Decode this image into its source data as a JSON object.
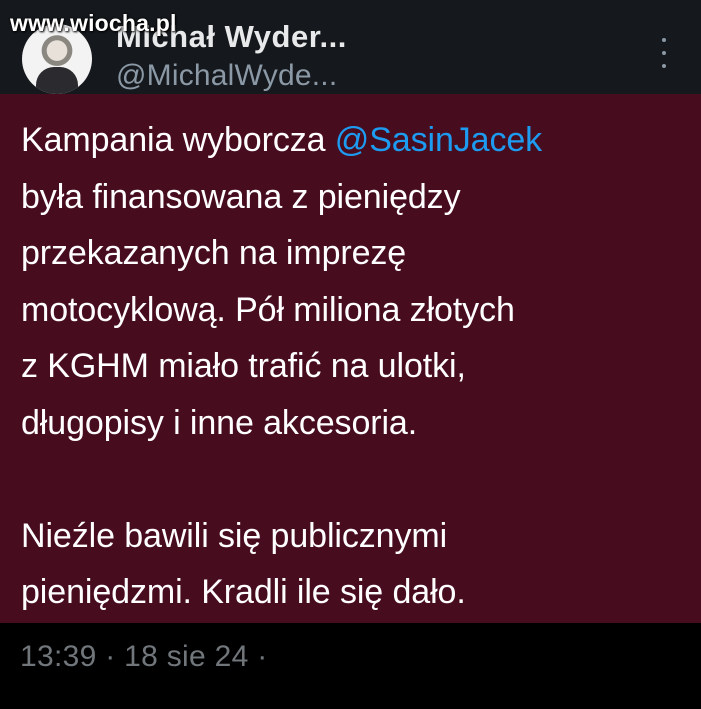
{
  "watermark": "www.wiocha.pl",
  "author": {
    "name": "Michał Wyder...",
    "handle": "@MichalWyde..."
  },
  "tweet": {
    "prefix": "Kampania wyborcza ",
    "mention": "@SasinJacek",
    "body": "\nbyła finansowana z pieniędzy\nprzekazanych na imprezę\nmotocyklową. Pół miliona złotych\nz KGHM miało trafić na ulotki,\ndługopisy i inne akcesoria.\n\nNieźle bawili się publicznymi\npieniędzmi. Kradli ile się dało."
  },
  "meta": "13:39 · 18 sie 24 ·",
  "colors": {
    "tweet_background": "#470d1f",
    "mention": "#1d9bf0"
  }
}
